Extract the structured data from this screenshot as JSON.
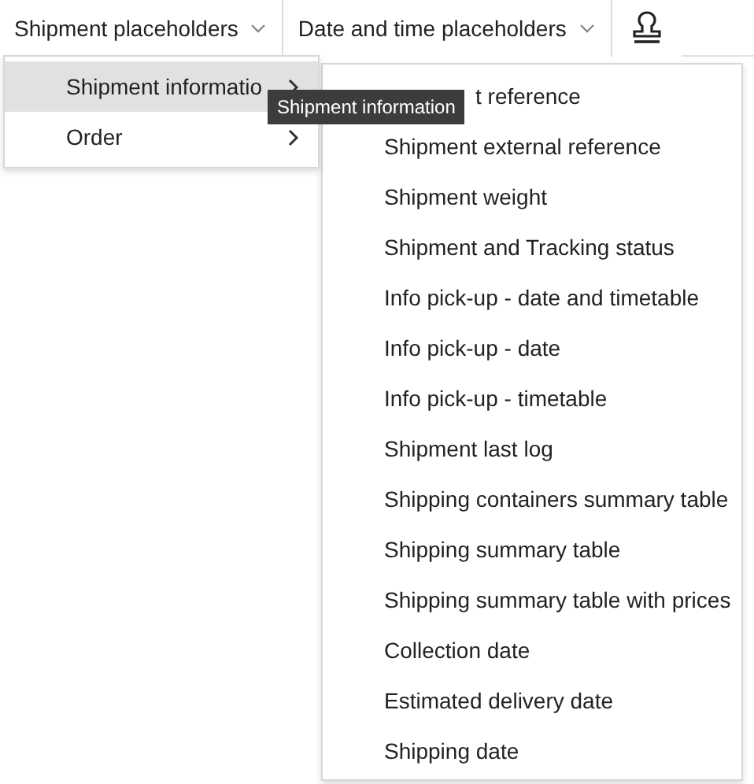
{
  "toolbar": [
    {
      "kind": "dropdown",
      "label": "Shipment placeholders"
    },
    {
      "kind": "dropdown",
      "label": "Date and time placeholders"
    },
    {
      "kind": "icon"
    }
  ],
  "menu": [
    {
      "label": "Shipment informatio",
      "selected": true
    },
    {
      "label": "Order",
      "selected": false
    }
  ],
  "tooltip": "Shipment information",
  "submenu": [
    "t reference",
    "Shipment external reference",
    "Shipment weight",
    "Shipment and Tracking status",
    "Info pick-up - date and timetable",
    "Info pick-up - date",
    "Info pick-up - timetable",
    "Shipment last log",
    "Shipping containers summary table",
    "Shipping summary table",
    "Shipping summary table with prices",
    "Collection date",
    "Estimated delivery date",
    "Shipping date"
  ]
}
